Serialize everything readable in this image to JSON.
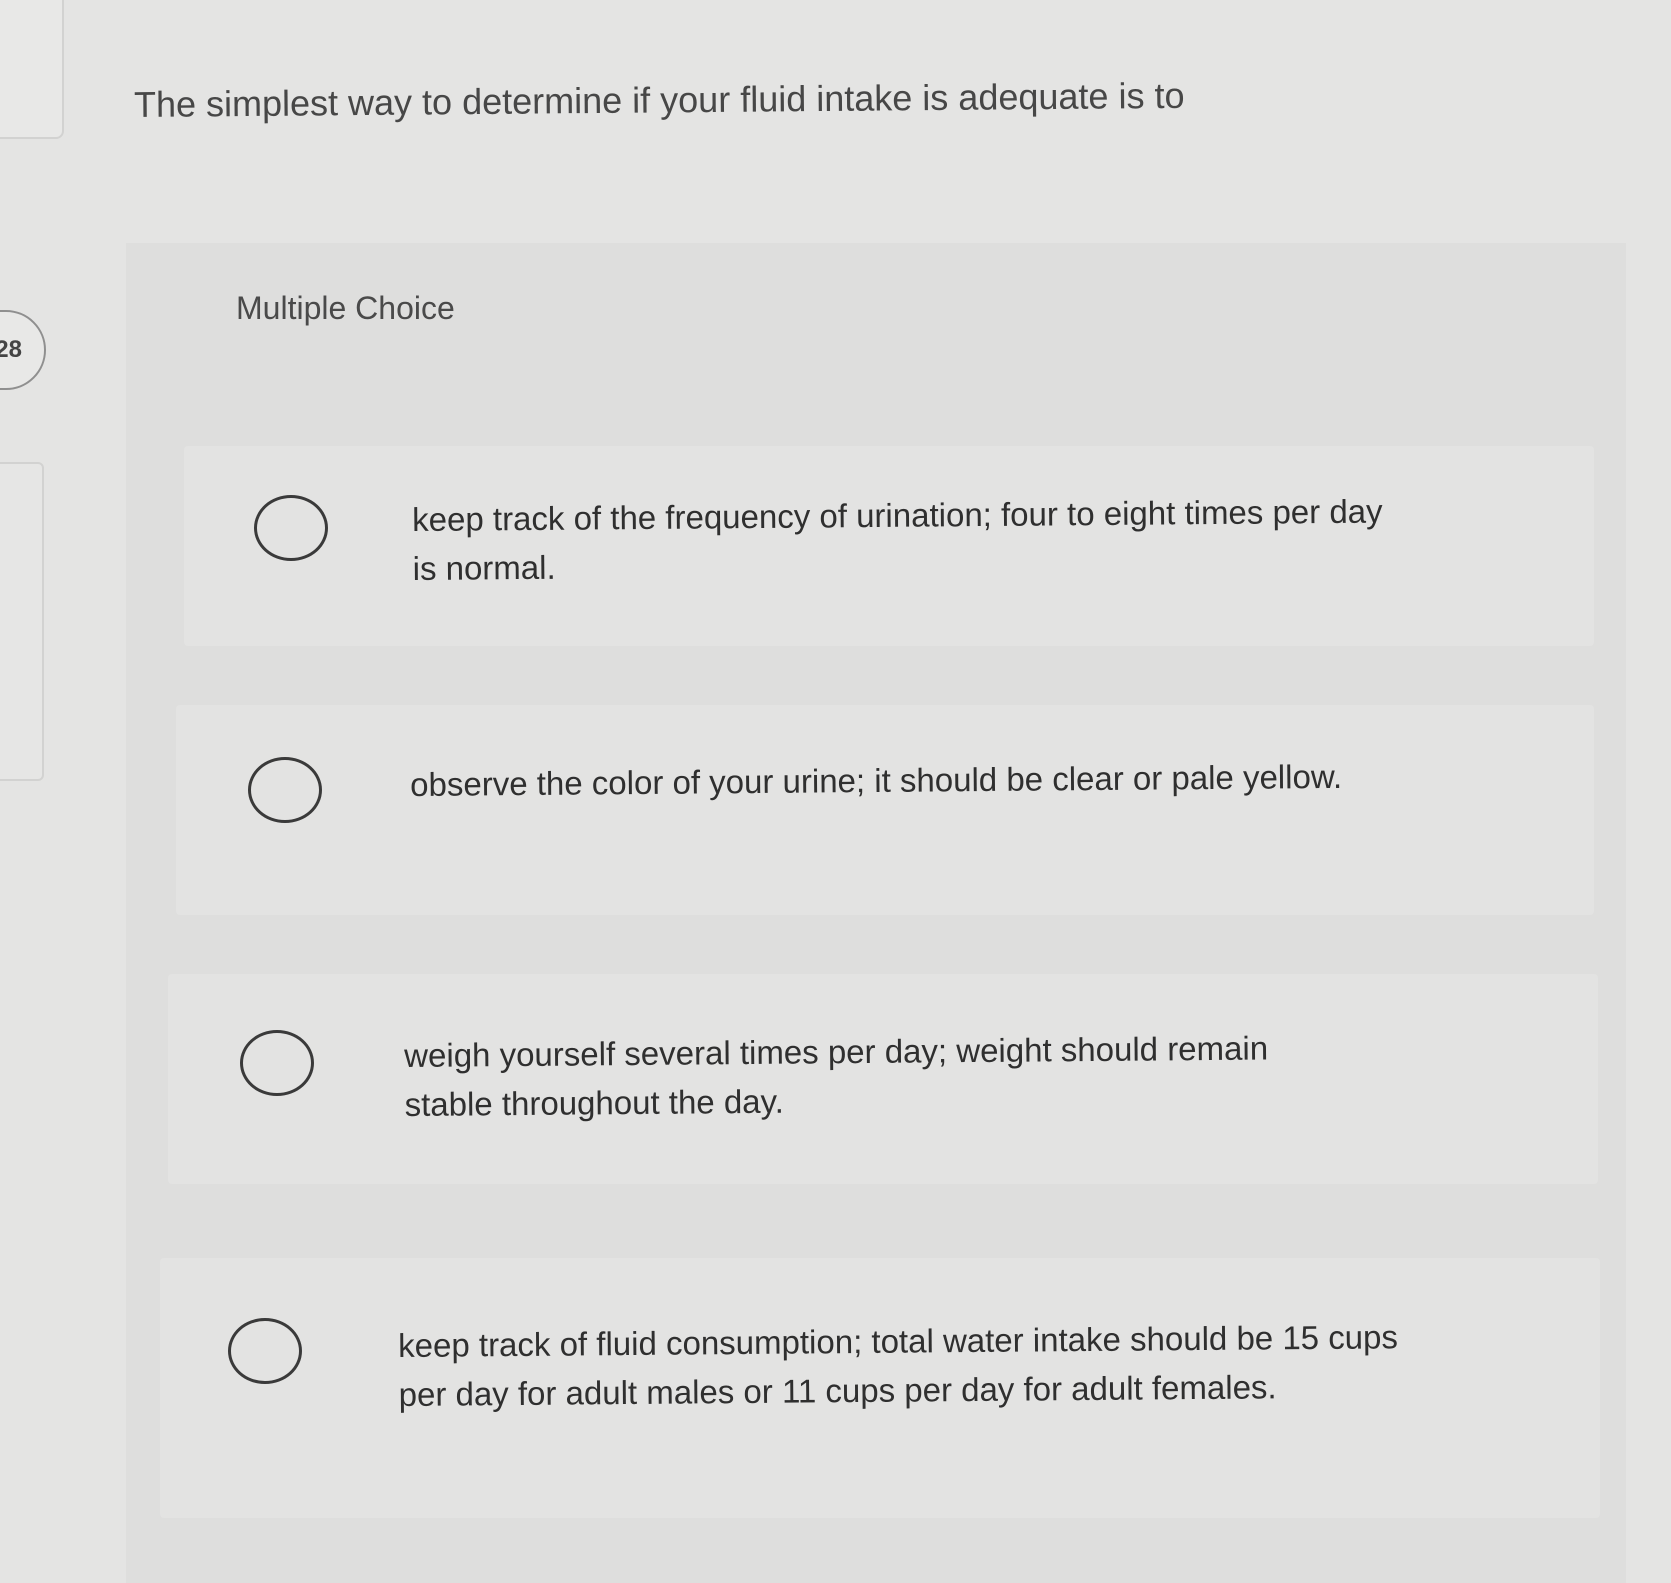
{
  "sidebar": {
    "question_number": "28"
  },
  "question": {
    "prompt": "The simplest way to determine if your fluid intake is adequate is to"
  },
  "choices_header": "Multiple Choice",
  "options": [
    {
      "text": "keep track of the frequency of urination; four to eight times per day is normal.",
      "selected": false
    },
    {
      "text": "observe the color of your urine; it should be clear or pale yellow.",
      "selected": false
    },
    {
      "text": "weigh yourself several times per day; weight should remain stable throughout the day.",
      "selected": false
    },
    {
      "text": "keep track of fluid consumption; total water intake should be 15 cups per day for adult males or 11 cups per day for adult females.",
      "selected": false
    }
  ]
}
